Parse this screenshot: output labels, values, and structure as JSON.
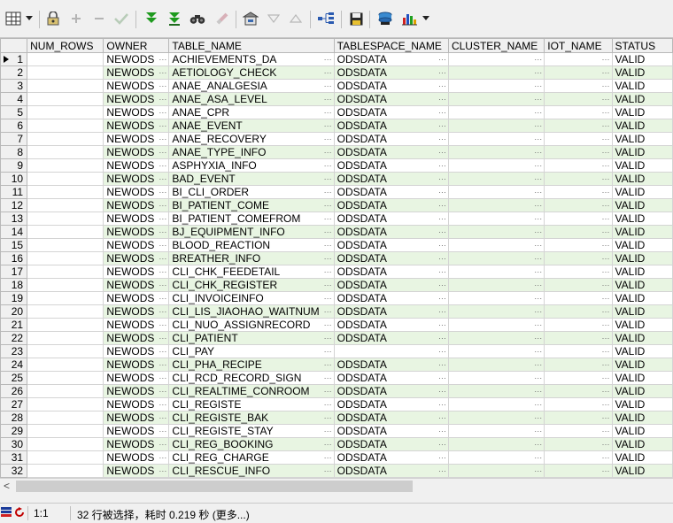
{
  "toolbar": {
    "icons": [
      "grid-view-icon",
      "dropdown-arrow-icon",
      "lock-icon",
      "add-icon",
      "remove-icon",
      "post-changes-icon",
      "fetch-next-icon",
      "fetch-all-icon",
      "find-icon",
      "clear-icon",
      "export-icon",
      "filter-icon",
      "sort-ascending-icon",
      "query-plan-icon",
      "save-icon",
      "connection-icon",
      "chart-icon"
    ]
  },
  "grid": {
    "columns": [
      "NUM_ROWS",
      "OWNER",
      "TABLE_NAME",
      "TABLESPACE_NAME",
      "CLUSTER_NAME",
      "IOT_NAME",
      "STATUS"
    ],
    "cell_ellipsis": "···",
    "rows": [
      {
        "n": "1",
        "owner": "NEWODS",
        "table": "ACHIEVEMENTS_DA",
        "tablespace": "ODSDATA",
        "status": "VALID"
      },
      {
        "n": "2",
        "owner": "NEWODS",
        "table": "AETIOLOGY_CHECK",
        "tablespace": "ODSDATA",
        "status": "VALID"
      },
      {
        "n": "3",
        "owner": "NEWODS",
        "table": "ANAE_ANALGESIA",
        "tablespace": "ODSDATA",
        "status": "VALID"
      },
      {
        "n": "4",
        "owner": "NEWODS",
        "table": "ANAE_ASA_LEVEL",
        "tablespace": "ODSDATA",
        "status": "VALID"
      },
      {
        "n": "5",
        "owner": "NEWODS",
        "table": "ANAE_CPR",
        "tablespace": "ODSDATA",
        "status": "VALID"
      },
      {
        "n": "6",
        "owner": "NEWODS",
        "table": "ANAE_EVENT",
        "tablespace": "ODSDATA",
        "status": "VALID"
      },
      {
        "n": "7",
        "owner": "NEWODS",
        "table": "ANAE_RECOVERY",
        "tablespace": "ODSDATA",
        "status": "VALID"
      },
      {
        "n": "8",
        "owner": "NEWODS",
        "table": "ANAE_TYPE_INFO",
        "tablespace": "ODSDATA",
        "status": "VALID"
      },
      {
        "n": "9",
        "owner": "NEWODS",
        "table": "ASPHYXIA_INFO",
        "tablespace": "ODSDATA",
        "status": "VALID"
      },
      {
        "n": "10",
        "owner": "NEWODS",
        "table": "BAD_EVENT",
        "tablespace": "ODSDATA",
        "status": "VALID"
      },
      {
        "n": "11",
        "owner": "NEWODS",
        "table": "BI_CLI_ORDER",
        "tablespace": "ODSDATA",
        "status": "VALID"
      },
      {
        "n": "12",
        "owner": "NEWODS",
        "table": "BI_PATIENT_COME",
        "tablespace": "ODSDATA",
        "status": "VALID"
      },
      {
        "n": "13",
        "owner": "NEWODS",
        "table": "BI_PATIENT_COMEFROM",
        "tablespace": "ODSDATA",
        "status": "VALID"
      },
      {
        "n": "14",
        "owner": "NEWODS",
        "table": "BJ_EQUIPMENT_INFO",
        "tablespace": "ODSDATA",
        "status": "VALID"
      },
      {
        "n": "15",
        "owner": "NEWODS",
        "table": "BLOOD_REACTION",
        "tablespace": "ODSDATA",
        "status": "VALID"
      },
      {
        "n": "16",
        "owner": "NEWODS",
        "table": "BREATHER_INFO",
        "tablespace": "ODSDATA",
        "status": "VALID"
      },
      {
        "n": "17",
        "owner": "NEWODS",
        "table": "CLI_CHK_FEEDETAIL",
        "tablespace": "ODSDATA",
        "status": "VALID"
      },
      {
        "n": "18",
        "owner": "NEWODS",
        "table": "CLI_CHK_REGISTER",
        "tablespace": "ODSDATA",
        "status": "VALID"
      },
      {
        "n": "19",
        "owner": "NEWODS",
        "table": "CLI_INVOICEINFO",
        "tablespace": "ODSDATA",
        "status": "VALID"
      },
      {
        "n": "20",
        "owner": "NEWODS",
        "table": "CLI_LIS_JIAOHAO_WAITNUM",
        "tablespace": "ODSDATA",
        "status": "VALID"
      },
      {
        "n": "21",
        "owner": "NEWODS",
        "table": "CLI_NUO_ASSIGNRECORD",
        "tablespace": "ODSDATA",
        "status": "VALID"
      },
      {
        "n": "22",
        "owner": "NEWODS",
        "table": "CLI_PATIENT",
        "tablespace": "ODSDATA",
        "status": "VALID"
      },
      {
        "n": "23",
        "owner": "NEWODS",
        "table": "CLI_PAY",
        "tablespace": "",
        "status": "VALID"
      },
      {
        "n": "24",
        "owner": "NEWODS",
        "table": "CLI_PHA_RECIPE",
        "tablespace": "ODSDATA",
        "status": "VALID"
      },
      {
        "n": "25",
        "owner": "NEWODS",
        "table": "CLI_RCD_RECORD_SIGN",
        "tablespace": "ODSDATA",
        "status": "VALID"
      },
      {
        "n": "26",
        "owner": "NEWODS",
        "table": "CLI_REALTIME_CONROOM",
        "tablespace": "ODSDATA",
        "status": "VALID"
      },
      {
        "n": "27",
        "owner": "NEWODS",
        "table": "CLI_REGISTE",
        "tablespace": "ODSDATA",
        "status": "VALID"
      },
      {
        "n": "28",
        "owner": "NEWODS",
        "table": "CLI_REGISTE_BAK",
        "tablespace": "ODSDATA",
        "status": "VALID"
      },
      {
        "n": "29",
        "owner": "NEWODS",
        "table": "CLI_REGISTE_STAY",
        "tablespace": "ODSDATA",
        "status": "VALID"
      },
      {
        "n": "30",
        "owner": "NEWODS",
        "table": "CLI_REG_BOOKING",
        "tablespace": "ODSDATA",
        "status": "VALID"
      },
      {
        "n": "31",
        "owner": "NEWODS",
        "table": "CLI_REG_CHARGE",
        "tablespace": "ODSDATA",
        "status": "VALID"
      },
      {
        "n": "32",
        "owner": "NEWODS",
        "table": "CLI_RESCUE_INFO",
        "tablespace": "ODSDATA",
        "status": "VALID"
      }
    ]
  },
  "scrollbar": {
    "left_arrow": "<"
  },
  "status": {
    "position": "1:1",
    "message": "32 行被选择，耗时 0.219 秒 (更多...)"
  }
}
